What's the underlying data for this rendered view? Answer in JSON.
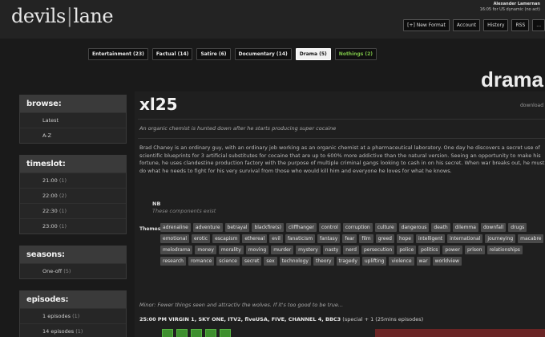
{
  "header": {
    "logo_left": "devils",
    "logo_sep": "|",
    "logo_right": "lane",
    "user": "Alexander Lamernan",
    "user_sub": "16:05 for US dynamic (no act)",
    "nav": [
      "[+] New Format",
      "Account",
      "History",
      "RSS",
      "..."
    ]
  },
  "categories": [
    {
      "label": "Entertainment (23)",
      "state": "normal"
    },
    {
      "label": "Factual (14)",
      "state": "normal"
    },
    {
      "label": "Satire (6)",
      "state": "normal"
    },
    {
      "label": "Documentary (14)",
      "state": "normal"
    },
    {
      "label": "Drama (5)",
      "state": "active"
    },
    {
      "label": "Nothings (2)",
      "state": "green"
    }
  ],
  "section_title": "drama",
  "sidebar": {
    "browse": {
      "title": "browse:",
      "items": [
        {
          "label": "Latest",
          "count": ""
        },
        {
          "label": "A-Z",
          "count": ""
        }
      ]
    },
    "timeslot": {
      "title": "timeslot:",
      "items": [
        {
          "label": "21:00",
          "count": "(1)"
        },
        {
          "label": "22:00",
          "count": "(2)"
        },
        {
          "label": "22:30",
          "count": "(1)"
        },
        {
          "label": "23:00",
          "count": "(1)"
        }
      ]
    },
    "seasons": {
      "title": "seasons:",
      "items": [
        {
          "label": "One-off",
          "count": "(5)"
        }
      ]
    },
    "episodes": {
      "title": "episodes:",
      "items": [
        {
          "label": "1 episodes",
          "count": "(1)"
        },
        {
          "label": "14 episodes",
          "count": "(1)"
        }
      ]
    }
  },
  "show": {
    "title": "xl25",
    "download": "download",
    "tagline": "An organic chemist is hunted down after he starts producing super cocaine",
    "description": "Brad Chaney is an ordinary guy, with an ordinary job working as an organic chemist at a pharmaceutical laboratory. One day he discovers a secret use of scientific blueprints for 3 artificial substitutes for cocaine that are up to 600% more addictive than the natural version. Seeing an opportunity to make his fortune, he uses clandestine production factory with the purpose of multiple criminal gangs looking to cash in on his secret. When war breaks out, he must do what he needs to fight for his very survival from those who would kill him and everyone he loves for what he knows.",
    "note_head": "NB",
    "note_text": "These components exist",
    "themes_label": "Themes:",
    "themes": [
      "adrenaline",
      "adventure",
      "betrayal",
      "blackfire(s)",
      "cliffhanger",
      "control",
      "corruption",
      "culture",
      "dangerous",
      "death",
      "dilemma",
      "downfall",
      "drugs",
      "emotional",
      "erotic",
      "escapism",
      "ethereal",
      "evil",
      "fanaticism",
      "fantasy",
      "fear",
      "film",
      "greed",
      "hope",
      "intelligent",
      "international",
      "journeying",
      "macabre",
      "melodrama",
      "money",
      "morality",
      "moving",
      "murder",
      "mystery",
      "nasty",
      "nerd",
      "persecution",
      "police",
      "politics",
      "power",
      "prison",
      "relationships",
      "research",
      "romance",
      "science",
      "secret",
      "sex",
      "technology",
      "theory",
      "tragedy",
      "uplifting",
      "violence",
      "war",
      "worldview"
    ],
    "minor_note": "Minor: Fewer things seen and attractiv the wolves. If it's too good to be true...",
    "eps_label": "25:00",
    "eps_channels": "PM VIRGIN 1, SKY ONE, ITV2, fiveUSA, FIVE, CHANNEL 4, BBC3",
    "eps_tail": "(special + 1 (25mins episodes)"
  }
}
